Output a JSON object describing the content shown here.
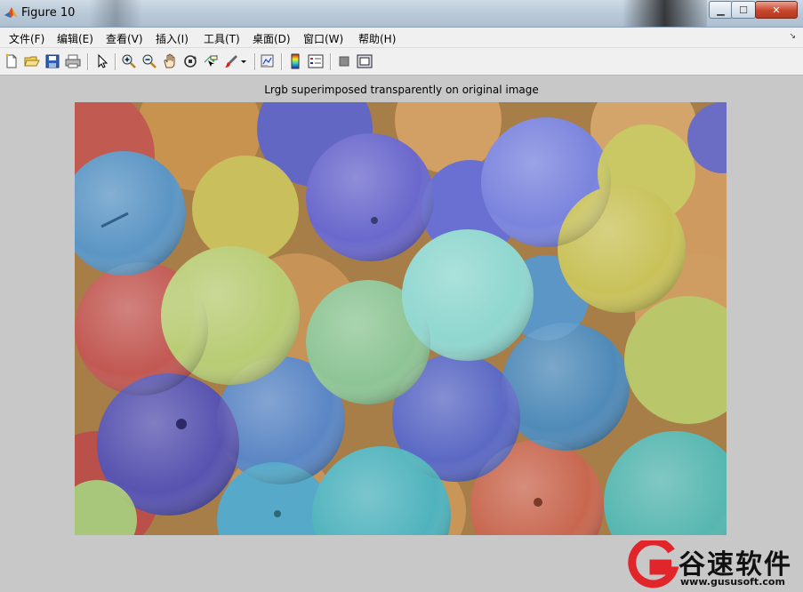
{
  "window": {
    "title": "Figure 10",
    "min_glyph": "▁",
    "max_glyph": "☐",
    "close_glyph": "✕"
  },
  "menu": {
    "items": [
      {
        "label": "文件(F)"
      },
      {
        "label": "编辑(E)"
      },
      {
        "label": "查看(V)"
      },
      {
        "label": "插入(I)"
      },
      {
        "label": "工具(T)"
      },
      {
        "label": "桌面(D)"
      },
      {
        "label": "窗口(W)"
      },
      {
        "label": "帮助(H)"
      }
    ],
    "overflow_glyph": "↘"
  },
  "toolbar": {
    "icons": [
      "new-figure-icon",
      "open-file-icon",
      "save-icon",
      "print-icon",
      "edit-plot-arrow-icon",
      "zoom-in-icon",
      "zoom-out-icon",
      "pan-hand-icon",
      "rotate-3d-icon",
      "data-cursor-icon",
      "brush-icon",
      "brush-dropdown-icon",
      "link-plot-icon",
      "colorbar-icon",
      "legend-icon",
      "hide-plot-tools-icon",
      "show-plot-tools-icon"
    ]
  },
  "figure": {
    "title": "Lrgb superimposed transparently on original image"
  },
  "watermark": {
    "text": "谷速软件",
    "url": "www.gususoft.com",
    "color": "#e0252b"
  }
}
